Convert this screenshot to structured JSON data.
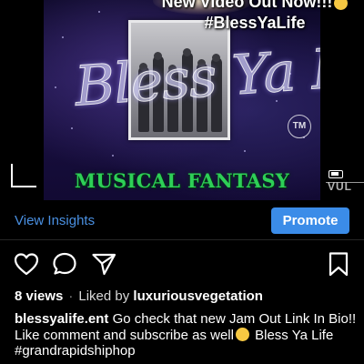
{
  "media": {
    "overlay_caption_line1": "New Video Out Now!!!",
    "overlay_caption_line2": "#BlessYaLife",
    "logo_text": "Bless Ya Life",
    "tm_mark": "TM",
    "video_title": "MUSICAL FANTASY",
    "watermark": "VUL"
  },
  "insights": {
    "view_insights_label": "View Insights",
    "promote_label": "Promote"
  },
  "actions": {
    "icons": [
      "heart-icon",
      "comment-icon",
      "share-icon",
      "bookmark-icon"
    ]
  },
  "post": {
    "views": "8 views",
    "separator": "·",
    "liked_prefix": "Liked by",
    "liked_by_user": "luxuriousvegetation",
    "author": "blessyalife.ent",
    "caption_part1": "Go check that new Jam Out Link In Bio!! Like comment and subscribe as well",
    "caption_part2": "Bless Ya Life #grandrapidshiphop"
  },
  "colors": {
    "link_blue": "#4a90e2",
    "button_blue": "#3b8ce8",
    "title_green": "#2ecf57",
    "background": "#000000"
  }
}
